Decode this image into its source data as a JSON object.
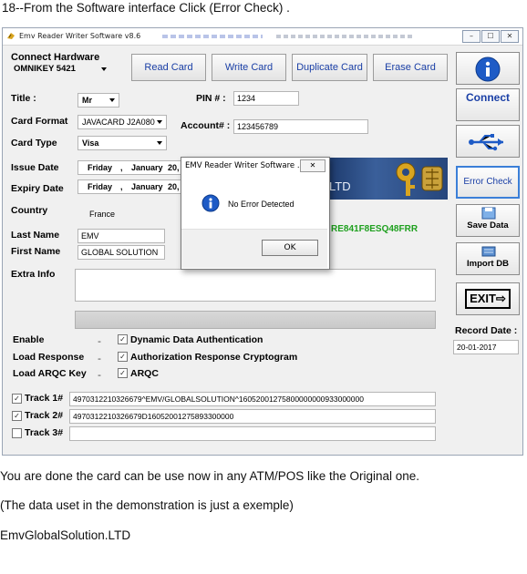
{
  "doc": {
    "heading": "18--From the Software interface Click (Error Check) .",
    "line1": "You are done the card can be use now in any ATM/POS like the Original one.",
    "line2": "(The data uset in the demonstration is just a exemple)",
    "line3": "EmvGlobalSolution.LTD"
  },
  "window": {
    "title": "Emv Reader Writer Software v8.6",
    "controls": [
      "–",
      "☐",
      "✕"
    ]
  },
  "hardware": {
    "label": "Connect Hardware",
    "reader": "OMNIKEY 5421"
  },
  "toolbar": {
    "read": "Read Card",
    "write": "Write Card",
    "duplicate": "Duplicate Card",
    "erase": "Erase Card"
  },
  "form": {
    "title_label": "Title :",
    "title_value": "Mr",
    "pin_label": "PIN # :",
    "pin_value": "1234",
    "card_format_label": "Card Format",
    "card_format_value": "JAVACARD J2A080",
    "account_label": "Account# :",
    "account_value": "123456789",
    "card_type_label": "Card Type",
    "card_type_value": "Visa",
    "issue_label": "Issue Date",
    "issue_day": "Friday",
    "issue_month": "January",
    "issue_num": "20,",
    "expiry_label": "Expiry Date",
    "expiry_day": "Friday",
    "expiry_month": "January",
    "expiry_num": "20,",
    "country_label": "Country",
    "country_value": "France",
    "last_name_label": "Last Name",
    "last_name_value": "EMV",
    "first_name_label": "First Name",
    "first_name_value": "GLOBAL SOLUTION",
    "extra_label": "Extra Info",
    "hash_text": "RE841F8ESQ48FRR",
    "ltd_text": "LTD"
  },
  "options": {
    "enable_label": "Enable",
    "enable_text": "Dynamic Data Authentication",
    "load_label": "Load Response",
    "load_text": "Authorization Response Cryptogram",
    "arqc_label": "Load ARQC Key",
    "arqc_text": "ARQC"
  },
  "tracks": [
    {
      "label": "Track 1#",
      "checked": true,
      "value": "4970312210326679^EMV/GLOBALSOLUTION^16052001275800000000933000000"
    },
    {
      "label": "Track 2#",
      "checked": true,
      "value": "4970312210326679D16052001275893300000"
    },
    {
      "label": "Track 3#",
      "checked": false,
      "value": ""
    }
  ],
  "right_panel": {
    "connect": "Connect",
    "error_check": "Error Check",
    "save": "Save Data",
    "import": "Import DB",
    "exit": "EXIT",
    "record_label": "Record Date :",
    "record_value": "20-01-2017"
  },
  "dialog": {
    "title": "EMV Reader Writer Software ...",
    "close": "✕",
    "message": "No Error Detected",
    "ok": "OK"
  },
  "colors": {
    "accent_blue": "#1a3fa6",
    "hash_green": "#1ea01e"
  }
}
